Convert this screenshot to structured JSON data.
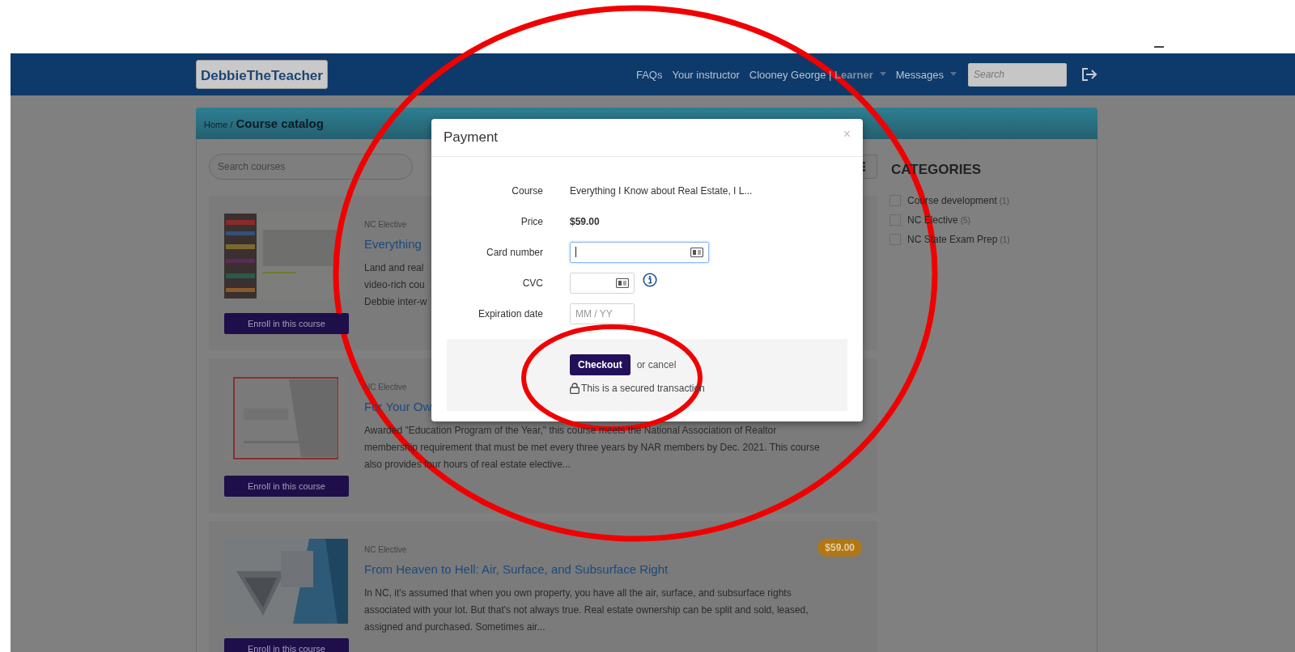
{
  "nav": {
    "logo": "DebbieTheTeacher",
    "links": [
      {
        "label": "FAQs",
        "dropdown": false
      },
      {
        "label": "Your instructor",
        "dropdown": false
      },
      {
        "label": "Clooney George | **Learner**",
        "dropdown": true
      },
      {
        "label": "Messages",
        "dropdown": true
      }
    ],
    "search": {
      "placeholder": "Search"
    }
  },
  "breadcrumb": {
    "home": "Home /",
    "current": "Course catalog"
  },
  "course_search": {
    "placeholder": "Search courses"
  },
  "courses": [
    {
      "category": "NC Elective",
      "title": "Everything",
      "description": [
        "Land and real",
        "video-rich cou",
        "Debbie inter-w"
      ],
      "enroll": "Enroll in this course"
    },
    {
      "category": "NC Elective",
      "title": "For Your Ow",
      "description": [
        "Awarded \"Education Program of the Year,\" this course meets the National Association of Realtor",
        "membership requirement that must be met every three years by NAR members by Dec. 2021. This course",
        "also provides four hours of real estate elective..."
      ],
      "enroll": "Enroll in this course"
    },
    {
      "category": "NC Elective",
      "title": "From Heaven to Hell: Air, Surface, and Subsurface Right",
      "price": "$59.00",
      "description": [
        "In NC, it's assumed that when you own property, you have all the air, surface, and subsurface rights",
        "associated with your lot. But that's not always true. Real estate ownership can be split and sold, leased,",
        "assigned and purchased. Sometimes air..."
      ],
      "enroll": "Enroll in this course"
    }
  ],
  "categories": {
    "title": "CATEGORIES",
    "items": [
      {
        "label": "Course development",
        "count": "(1)",
        "checked": false
      },
      {
        "label": "NC Elective",
        "count": "(5)",
        "checked": false
      },
      {
        "label": "NC State Exam Prep",
        "count": "(1)",
        "checked": false
      }
    ]
  },
  "modal": {
    "title": "Payment",
    "close": "×",
    "fields": [
      {
        "kind": "text",
        "label": "Course",
        "value": "Everything I Know about Real Estate, I L..."
      },
      {
        "kind": "price",
        "label": "Price",
        "value": "$59.00"
      },
      {
        "kind": "card",
        "label": "Card number",
        "focused": true
      },
      {
        "kind": "cvc",
        "label": "CVC",
        "focused": false
      },
      {
        "kind": "date",
        "label": "Expiration date",
        "focused": false,
        "placeholder": "MM / YY"
      }
    ],
    "checkout": "Checkout",
    "cancel": "or cancel",
    "secure_note": "This is a secured transaction"
  }
}
